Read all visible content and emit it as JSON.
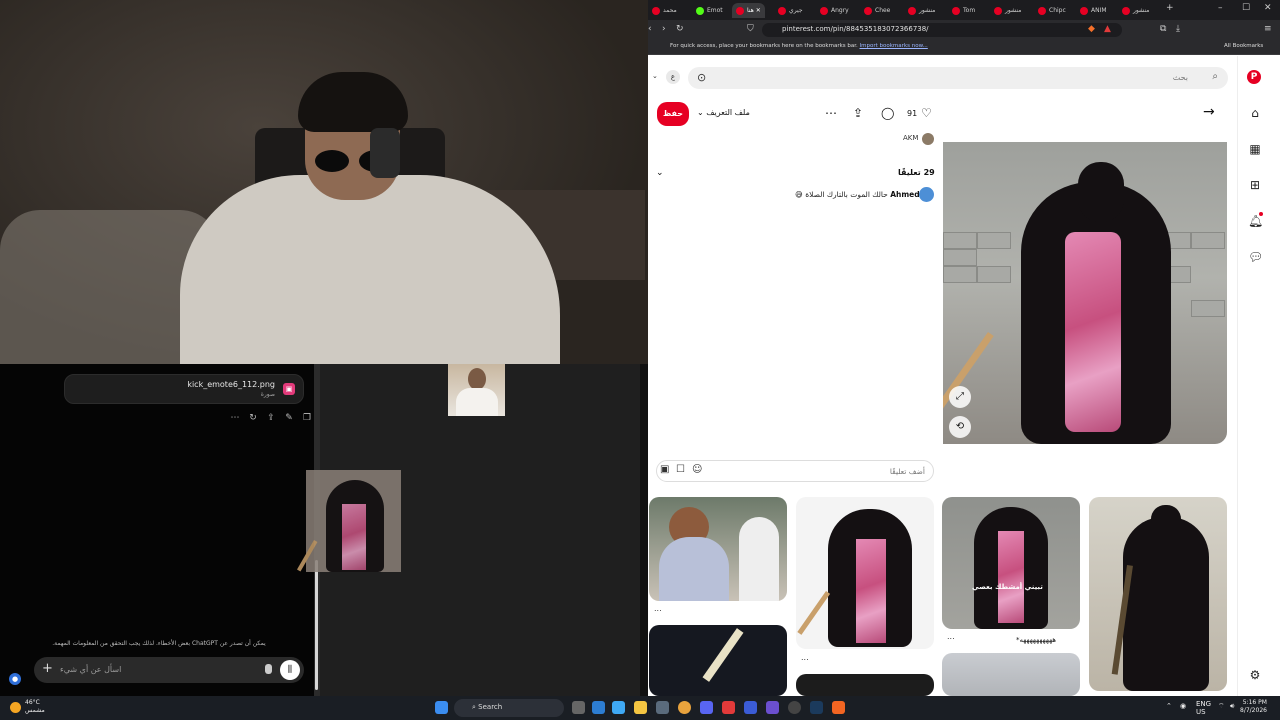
{
  "chat": {
    "file_name": "kick_emote6_112.png",
    "file_type": "صورة",
    "disclaimer": "يمكن أن تصدر عن ChatGPT بعض الأخطاء. لذلك يجب التحقق من المعلومات المهمة.",
    "input_placeholder": "اسأل عن أي شيء"
  },
  "browser": {
    "tabs": [
      "محمد",
      "Emot",
      "هنا",
      "جيري",
      "Angry",
      "Chee",
      "منشور",
      "Tom",
      "منشور",
      "Chipc",
      "ANIM",
      "منشور"
    ],
    "url": "pinterest.com/pin/884535183072366738/",
    "bookmarks_text": "For quick access, place your bookmarks here on the bookmarks bar.",
    "bookmarks_link": "Import bookmarks now...",
    "all_bookmarks": "All Bookmarks"
  },
  "pin": {
    "search_placeholder": "بحث",
    "avatar_letter": "ع",
    "save_label": "حفظ",
    "profile_label": "ملف التعريف",
    "like_count": "91",
    "creator": "AKM",
    "comments_header": "29 تعليقًا",
    "comment_author": "Ahmed",
    "comment_text": "حالك الموت بالتارك الصلاة",
    "add_comment_placeholder": "أضف تعليقًا",
    "grid_captions": [
      "...",
      "...",
      "...",
      "*ههههههههههه"
    ],
    "overlay_text": "تبيني أمشطك بعصي"
  },
  "taskbar": {
    "temp": "46°C",
    "weather_desc": "مشمس",
    "search": "Search",
    "lang": "ENG",
    "region": "US",
    "time": "5:16 PM",
    "date": "8/7/2026"
  }
}
